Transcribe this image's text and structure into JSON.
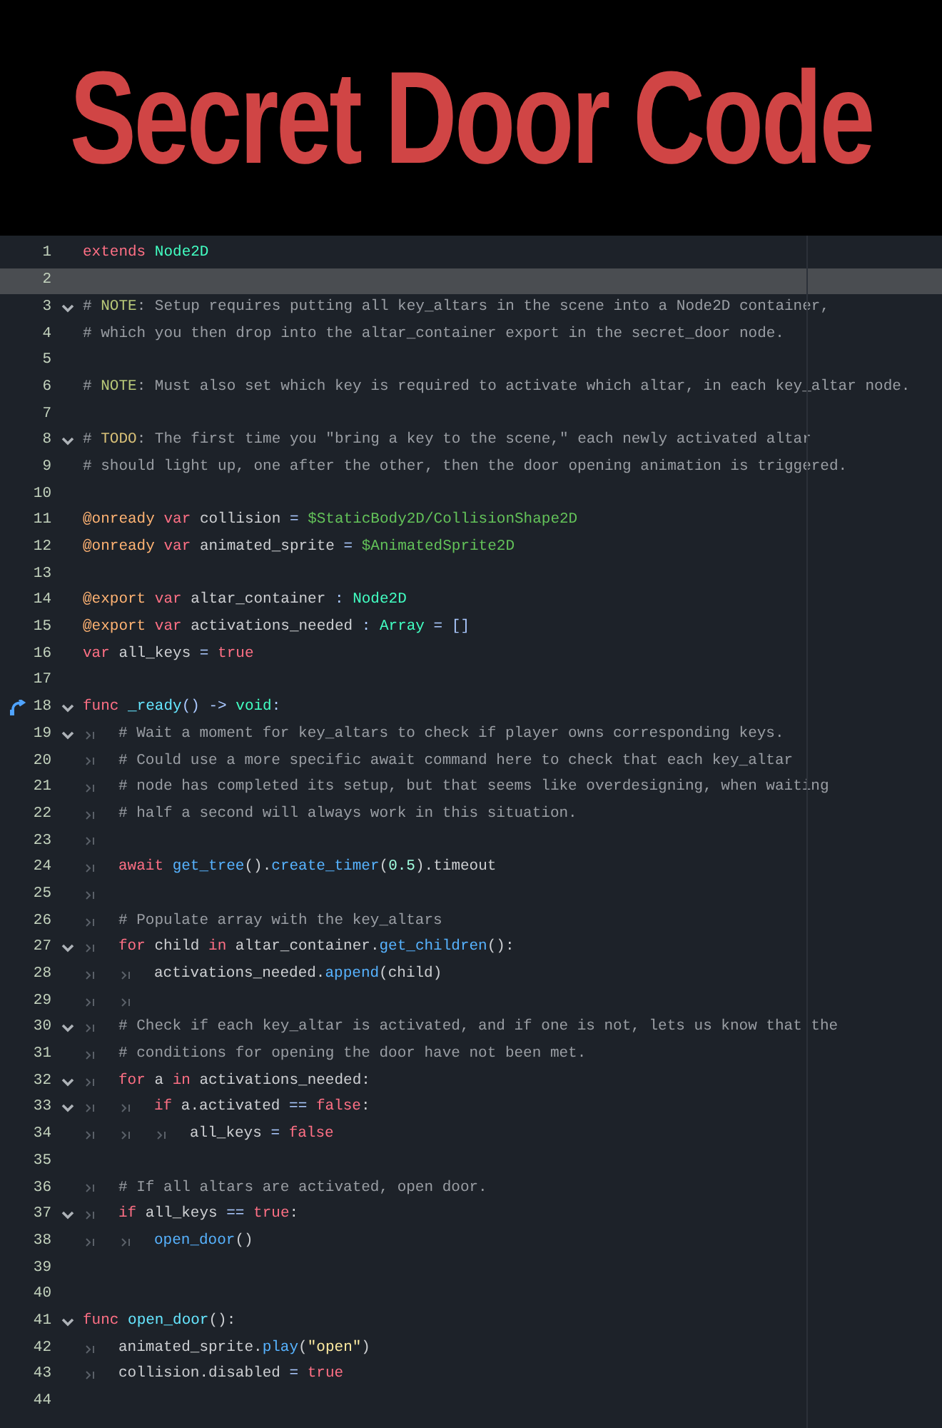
{
  "title": "Secret Door Code",
  "editor": {
    "lines": [
      {
        "number": "1",
        "current": false,
        "foldable": false,
        "connected": false,
        "tokens": [
          {
            "kind": "keyword",
            "text": "extends"
          },
          {
            "kind": "type",
            "text": " Node2D"
          }
        ]
      },
      {
        "number": "2",
        "current": true,
        "foldable": false,
        "connected": false
      },
      {
        "number": "3",
        "current": false,
        "foldable": true,
        "connected": false,
        "tokens": [
          {
            "kind": "comment",
            "text": "# "
          },
          {
            "kind": "note",
            "text": "NOTE"
          },
          {
            "kind": "comment",
            "text": ": Setup requires putting all key_altars in the scene into a Node2D container,"
          }
        ]
      },
      {
        "number": "4",
        "current": false,
        "foldable": false,
        "connected": false,
        "tokens": [
          {
            "kind": "comment",
            "text": "# which you then drop into the altar_container export in the secret_door node."
          }
        ]
      },
      {
        "number": "5",
        "current": false,
        "foldable": false,
        "connected": false
      },
      {
        "number": "6",
        "current": false,
        "foldable": false,
        "connected": false,
        "tokens": [
          {
            "kind": "comment",
            "text": "# "
          },
          {
            "kind": "note",
            "text": "NOTE"
          },
          {
            "kind": "comment",
            "text": ": Must also set which key is required to activate which altar, in each key_altar node."
          }
        ]
      },
      {
        "number": "7",
        "current": false,
        "foldable": false,
        "connected": false
      },
      {
        "number": "8",
        "current": false,
        "foldable": true,
        "connected": false,
        "tokens": [
          {
            "kind": "comment",
            "text": "# "
          },
          {
            "kind": "todo",
            "text": "TODO"
          },
          {
            "kind": "comment",
            "text": ": The first time you \"bring a key to the scene,\" each newly activated altar"
          }
        ]
      },
      {
        "number": "9",
        "current": false,
        "foldable": false,
        "connected": false,
        "tokens": [
          {
            "kind": "comment",
            "text": "# should light up, one after the other, then the door opening animation is triggered."
          }
        ]
      },
      {
        "number": "10",
        "current": false,
        "foldable": false,
        "connected": false
      },
      {
        "number": "11",
        "current": false,
        "foldable": false,
        "connected": false,
        "tokens": [
          {
            "kind": "annotation",
            "text": "@onready"
          },
          {
            "kind": "keyword",
            "text": " var"
          },
          {
            "kind": "plain",
            "text": " collision "
          },
          {
            "kind": "symbol",
            "text": "="
          },
          {
            "kind": "nodepath",
            "text": " $StaticBody2D/CollisionShape2D"
          }
        ]
      },
      {
        "number": "12",
        "current": false,
        "foldable": false,
        "connected": false,
        "tokens": [
          {
            "kind": "annotation",
            "text": "@onready"
          },
          {
            "kind": "keyword",
            "text": " var"
          },
          {
            "kind": "plain",
            "text": " animated_sprite "
          },
          {
            "kind": "symbol",
            "text": "="
          },
          {
            "kind": "nodepath",
            "text": " $AnimatedSprite2D"
          }
        ]
      },
      {
        "number": "13",
        "current": false,
        "foldable": false,
        "connected": false
      },
      {
        "number": "14",
        "current": false,
        "foldable": false,
        "connected": false,
        "tokens": [
          {
            "kind": "annotation",
            "text": "@export"
          },
          {
            "kind": "keyword",
            "text": " var"
          },
          {
            "kind": "plain",
            "text": " altar_container "
          },
          {
            "kind": "symbol",
            "text": ":"
          },
          {
            "kind": "type",
            "text": " Node2D"
          }
        ]
      },
      {
        "number": "15",
        "current": false,
        "foldable": false,
        "connected": false,
        "tokens": [
          {
            "kind": "annotation",
            "text": "@export"
          },
          {
            "kind": "keyword",
            "text": " var"
          },
          {
            "kind": "plain",
            "text": " activations_needed "
          },
          {
            "kind": "symbol",
            "text": ":"
          },
          {
            "kind": "type",
            "text": " Array"
          },
          {
            "kind": "symbol",
            "text": " = []"
          }
        ]
      },
      {
        "number": "16",
        "current": false,
        "foldable": false,
        "connected": false,
        "tokens": [
          {
            "kind": "keyword",
            "text": "var"
          },
          {
            "kind": "plain",
            "text": " all_keys "
          },
          {
            "kind": "symbol",
            "text": "="
          },
          {
            "kind": "keyword",
            "text": " true"
          }
        ]
      },
      {
        "number": "17",
        "current": false,
        "foldable": false,
        "connected": false
      },
      {
        "number": "18",
        "current": false,
        "foldable": true,
        "connected": true,
        "tokens": [
          {
            "kind": "keyword",
            "text": "func"
          },
          {
            "kind": "funcdef",
            "text": " _ready"
          },
          {
            "kind": "symbol",
            "text": "() ->"
          },
          {
            "kind": "type",
            "text": " void"
          },
          {
            "kind": "symbol",
            "text": ":"
          }
        ]
      },
      {
        "number": "19",
        "current": false,
        "foldable": true,
        "connected": false,
        "indent": [
          {
            "kind": "tab"
          }
        ],
        "tokens": [
          {
            "kind": "comment",
            "text": "# Wait a moment for key_altars to check if player owns corresponding keys."
          }
        ]
      },
      {
        "number": "20",
        "current": false,
        "foldable": false,
        "connected": false,
        "indent": [
          {
            "kind": "tab"
          }
        ],
        "tokens": [
          {
            "kind": "comment",
            "text": "# Could use a more specific await command here to check that each key_altar"
          }
        ]
      },
      {
        "number": "21",
        "current": false,
        "foldable": false,
        "connected": false,
        "indent": [
          {
            "kind": "tab"
          }
        ],
        "tokens": [
          {
            "kind": "comment",
            "text": "# node has completed its setup, but that seems like overdesigning, when waiting"
          }
        ]
      },
      {
        "number": "22",
        "current": false,
        "foldable": false,
        "connected": false,
        "indent": [
          {
            "kind": "tab"
          }
        ],
        "tokens": [
          {
            "kind": "comment",
            "text": "# half a second will always work in this situation."
          }
        ]
      },
      {
        "number": "23",
        "current": false,
        "foldable": false,
        "connected": false,
        "indent": [
          {
            "kind": "tab"
          }
        ]
      },
      {
        "number": "24",
        "current": false,
        "foldable": false,
        "connected": false,
        "indent": [
          {
            "kind": "tab"
          }
        ],
        "tokens": [
          {
            "kind": "keyword",
            "text": "await"
          },
          {
            "kind": "call",
            "text": " get_tree"
          },
          {
            "kind": "plain",
            "text": "()."
          },
          {
            "kind": "call",
            "text": "create_timer"
          },
          {
            "kind": "plain",
            "text": "("
          },
          {
            "kind": "number",
            "text": "0.5"
          },
          {
            "kind": "plain",
            "text": ").timeout"
          }
        ]
      },
      {
        "number": "25",
        "current": false,
        "foldable": false,
        "connected": false,
        "indent": [
          {
            "kind": "tab"
          }
        ]
      },
      {
        "number": "26",
        "current": false,
        "foldable": false,
        "connected": false,
        "indent": [
          {
            "kind": "tab"
          }
        ],
        "tokens": [
          {
            "kind": "comment",
            "text": "# Populate array with the key_altars"
          }
        ]
      },
      {
        "number": "27",
        "current": false,
        "foldable": true,
        "connected": false,
        "indent": [
          {
            "kind": "tab"
          }
        ],
        "tokens": [
          {
            "kind": "keyword",
            "text": "for"
          },
          {
            "kind": "plain",
            "text": " child "
          },
          {
            "kind": "keyword",
            "text": "in"
          },
          {
            "kind": "plain",
            "text": " altar_container."
          },
          {
            "kind": "call",
            "text": "get_children"
          },
          {
            "kind": "plain",
            "text": "():"
          }
        ]
      },
      {
        "number": "28",
        "current": false,
        "foldable": false,
        "connected": false,
        "indent": [
          {
            "kind": "tab"
          },
          {
            "kind": "tab"
          }
        ],
        "tokens": [
          {
            "kind": "plain",
            "text": "activations_needed."
          },
          {
            "kind": "call",
            "text": "append"
          },
          {
            "kind": "plain",
            "text": "(child)"
          }
        ]
      },
      {
        "number": "29",
        "current": false,
        "foldable": false,
        "connected": false,
        "indent": [
          {
            "kind": "tab"
          },
          {
            "kind": "tab"
          }
        ]
      },
      {
        "number": "30",
        "current": false,
        "foldable": true,
        "connected": false,
        "indent": [
          {
            "kind": "tab"
          }
        ],
        "tokens": [
          {
            "kind": "comment",
            "text": "# Check if each key_altar is activated, and if one is not, lets us know that the"
          }
        ]
      },
      {
        "number": "31",
        "current": false,
        "foldable": false,
        "connected": false,
        "indent": [
          {
            "kind": "tab"
          }
        ],
        "tokens": [
          {
            "kind": "comment",
            "text": "# conditions for opening the door have not been met."
          }
        ]
      },
      {
        "number": "32",
        "current": false,
        "foldable": true,
        "connected": false,
        "indent": [
          {
            "kind": "tab"
          }
        ],
        "tokens": [
          {
            "kind": "keyword",
            "text": "for"
          },
          {
            "kind": "plain",
            "text": " a "
          },
          {
            "kind": "keyword",
            "text": "in"
          },
          {
            "kind": "plain",
            "text": " activations_needed:"
          }
        ]
      },
      {
        "number": "33",
        "current": false,
        "foldable": true,
        "connected": false,
        "indent": [
          {
            "kind": "tab"
          },
          {
            "kind": "tab"
          }
        ],
        "tokens": [
          {
            "kind": "keyword",
            "text": "if"
          },
          {
            "kind": "plain",
            "text": " a.activated "
          },
          {
            "kind": "symbol",
            "text": "=="
          },
          {
            "kind": "keyword",
            "text": " false"
          },
          {
            "kind": "plain",
            "text": ":"
          }
        ]
      },
      {
        "number": "34",
        "current": false,
        "foldable": false,
        "connected": false,
        "indent": [
          {
            "kind": "tab"
          },
          {
            "kind": "tab"
          },
          {
            "kind": "tab"
          }
        ],
        "tokens": [
          {
            "kind": "plain",
            "text": "all_keys "
          },
          {
            "kind": "symbol",
            "text": "="
          },
          {
            "kind": "keyword",
            "text": " false"
          }
        ]
      },
      {
        "number": "35",
        "current": false,
        "foldable": false,
        "connected": false
      },
      {
        "number": "36",
        "current": false,
        "foldable": false,
        "connected": false,
        "indent": [
          {
            "kind": "tab"
          }
        ],
        "tokens": [
          {
            "kind": "comment",
            "text": "# If all altars are activated, open door."
          }
        ]
      },
      {
        "number": "37",
        "current": false,
        "foldable": true,
        "connected": false,
        "indent": [
          {
            "kind": "tab"
          }
        ],
        "tokens": [
          {
            "kind": "keyword",
            "text": "if"
          },
          {
            "kind": "plain",
            "text": " all_keys "
          },
          {
            "kind": "symbol",
            "text": "=="
          },
          {
            "kind": "keyword",
            "text": " true"
          },
          {
            "kind": "plain",
            "text": ":"
          }
        ]
      },
      {
        "number": "38",
        "current": false,
        "foldable": false,
        "connected": false,
        "indent": [
          {
            "kind": "tab"
          },
          {
            "kind": "tab"
          }
        ],
        "tokens": [
          {
            "kind": "call",
            "text": "open_door"
          },
          {
            "kind": "plain",
            "text": "()"
          }
        ]
      },
      {
        "number": "39",
        "current": false,
        "foldable": false,
        "connected": false
      },
      {
        "number": "40",
        "current": false,
        "foldable": false,
        "connected": false
      },
      {
        "number": "41",
        "current": false,
        "foldable": true,
        "connected": false,
        "tokens": [
          {
            "kind": "keyword",
            "text": "func"
          },
          {
            "kind": "funcdef",
            "text": " open_door"
          },
          {
            "kind": "plain",
            "text": "():"
          }
        ]
      },
      {
        "number": "42",
        "current": false,
        "foldable": false,
        "connected": false,
        "indent": [
          {
            "kind": "tab"
          }
        ],
        "tokens": [
          {
            "kind": "plain",
            "text": "animated_sprite."
          },
          {
            "kind": "call",
            "text": "play"
          },
          {
            "kind": "plain",
            "text": "("
          },
          {
            "kind": "string",
            "text": "\"open\""
          },
          {
            "kind": "plain",
            "text": ")"
          }
        ]
      },
      {
        "number": "43",
        "current": false,
        "foldable": false,
        "connected": false,
        "indent": [
          {
            "kind": "tab"
          }
        ],
        "tokens": [
          {
            "kind": "plain",
            "text": "collision.disabled "
          },
          {
            "kind": "symbol",
            "text": "="
          },
          {
            "kind": "keyword",
            "text": " true"
          }
        ]
      },
      {
        "number": "44",
        "current": false,
        "foldable": false,
        "connected": false
      }
    ]
  }
}
